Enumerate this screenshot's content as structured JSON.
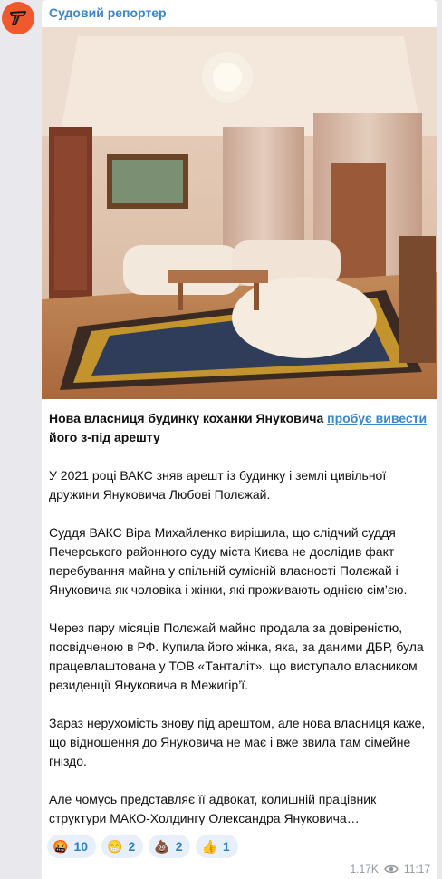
{
  "channel": {
    "name": "Судовий репортер"
  },
  "photo": {
    "alt_icon": "living-room-photo"
  },
  "post": {
    "headline_before_link": "Нова власниця будинку коханки Януковича ",
    "headline_link": "пробує вивести",
    "headline_after_link": " його з-під арешту",
    "paragraphs": [
      "У 2021 році ВАКС зняв арешт із будинку і землі цивільної дружини Януковича Любові Полєжай.",
      "Суддя ВАКС Віра Михайленко вирішила, що слідчий суддя Печерського районного суду міста Києва не дослідив  факт перебування майна у спільній сумісній власності Полєжай і Януковича як чоловіка і жінки, які проживають однією сім’єю.",
      "Через пару місяців Полєжай майно продала за довіреністю, посвідченою в РФ. Купила його жінка, яка, за даними ДБР, була працевлаштована у ТОВ «Танталіт», що виступало власником резиденції Януковича в Межигір’ї.",
      "Зараз нерухомість знову під арештом, але нова власниця каже, що відношення до Януковича не має і вже звила там сімейне гніздо.",
      "Але чомусь представляє її адвокат, колишній працівник структури МАКО-Холдингу Олександра Януковича…"
    ]
  },
  "reactions": [
    {
      "emoji": "🤬",
      "count": "10"
    },
    {
      "emoji": "😁",
      "count": "2"
    },
    {
      "emoji": "💩",
      "count": "2"
    },
    {
      "emoji": "👍",
      "count": "1"
    }
  ],
  "meta": {
    "views": "1.17K",
    "time": "11:17",
    "eye_icon": "eye-icon"
  },
  "colors": {
    "accent": "#3a86c8",
    "avatar_bg": "#f0582e",
    "reaction_bg": "#e7f0fa"
  }
}
